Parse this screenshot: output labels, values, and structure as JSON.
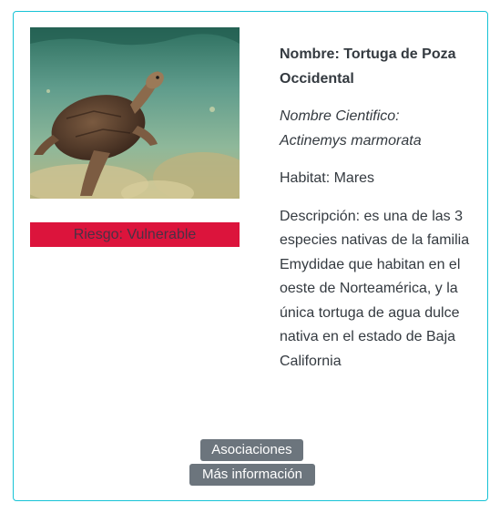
{
  "card": {
    "image": {
      "subject": "turtle-photo",
      "colors": {
        "water_top": "#2e7d6a",
        "water_mid": "#6fa79a",
        "sand": "#c9c08a",
        "shell": "#5a4030",
        "skin": "#8b6a4c"
      }
    },
    "risk_label": "Riesgo: Vulnerable",
    "risk_color": "#dc143c",
    "name": "Nombre: Tortuga de Poza Occidental",
    "scientific_name_label": "Nombre Cientifico:",
    "scientific_name": "Actinemys marmorata",
    "habitat": "Habitat: Mares",
    "description": "Descripción: es una de las 3 especies nativas de la familia Emydidae que habitan en el oeste de Norteamérica, y la única tortuga de agua dulce nativa en el estado de Baja California",
    "buttons": {
      "associations": "Asociaciones",
      "more_info": "Más información"
    },
    "border_color": "#17c3d6",
    "button_color": "#6c757d"
  }
}
